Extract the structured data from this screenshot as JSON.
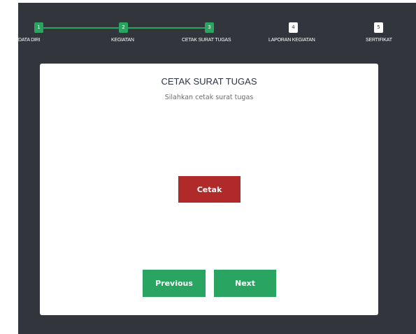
{
  "steps": [
    {
      "number": "1",
      "label": "DATA DIRI",
      "status": "done"
    },
    {
      "number": "2",
      "label": "KEGIATAN",
      "status": "done"
    },
    {
      "number": "3",
      "label": "CETAK SURAT TUGAS",
      "status": "done"
    },
    {
      "number": "4",
      "label": "LAPORAN KEGIATAN",
      "status": "todo"
    },
    {
      "number": "5",
      "label": "SERTIFIKAT",
      "status": "todo"
    }
  ],
  "card": {
    "title": "CETAK SURAT TUGAS",
    "subtitle": "Silahkan cetak surat tugas",
    "print_label": "Cetak",
    "previous_label": "Previous",
    "next_label": "Next"
  },
  "colors": {
    "background": "#32363c",
    "accent_green": "#2aa561",
    "print_red": "#b02a2a",
    "card": "#ffffff"
  }
}
